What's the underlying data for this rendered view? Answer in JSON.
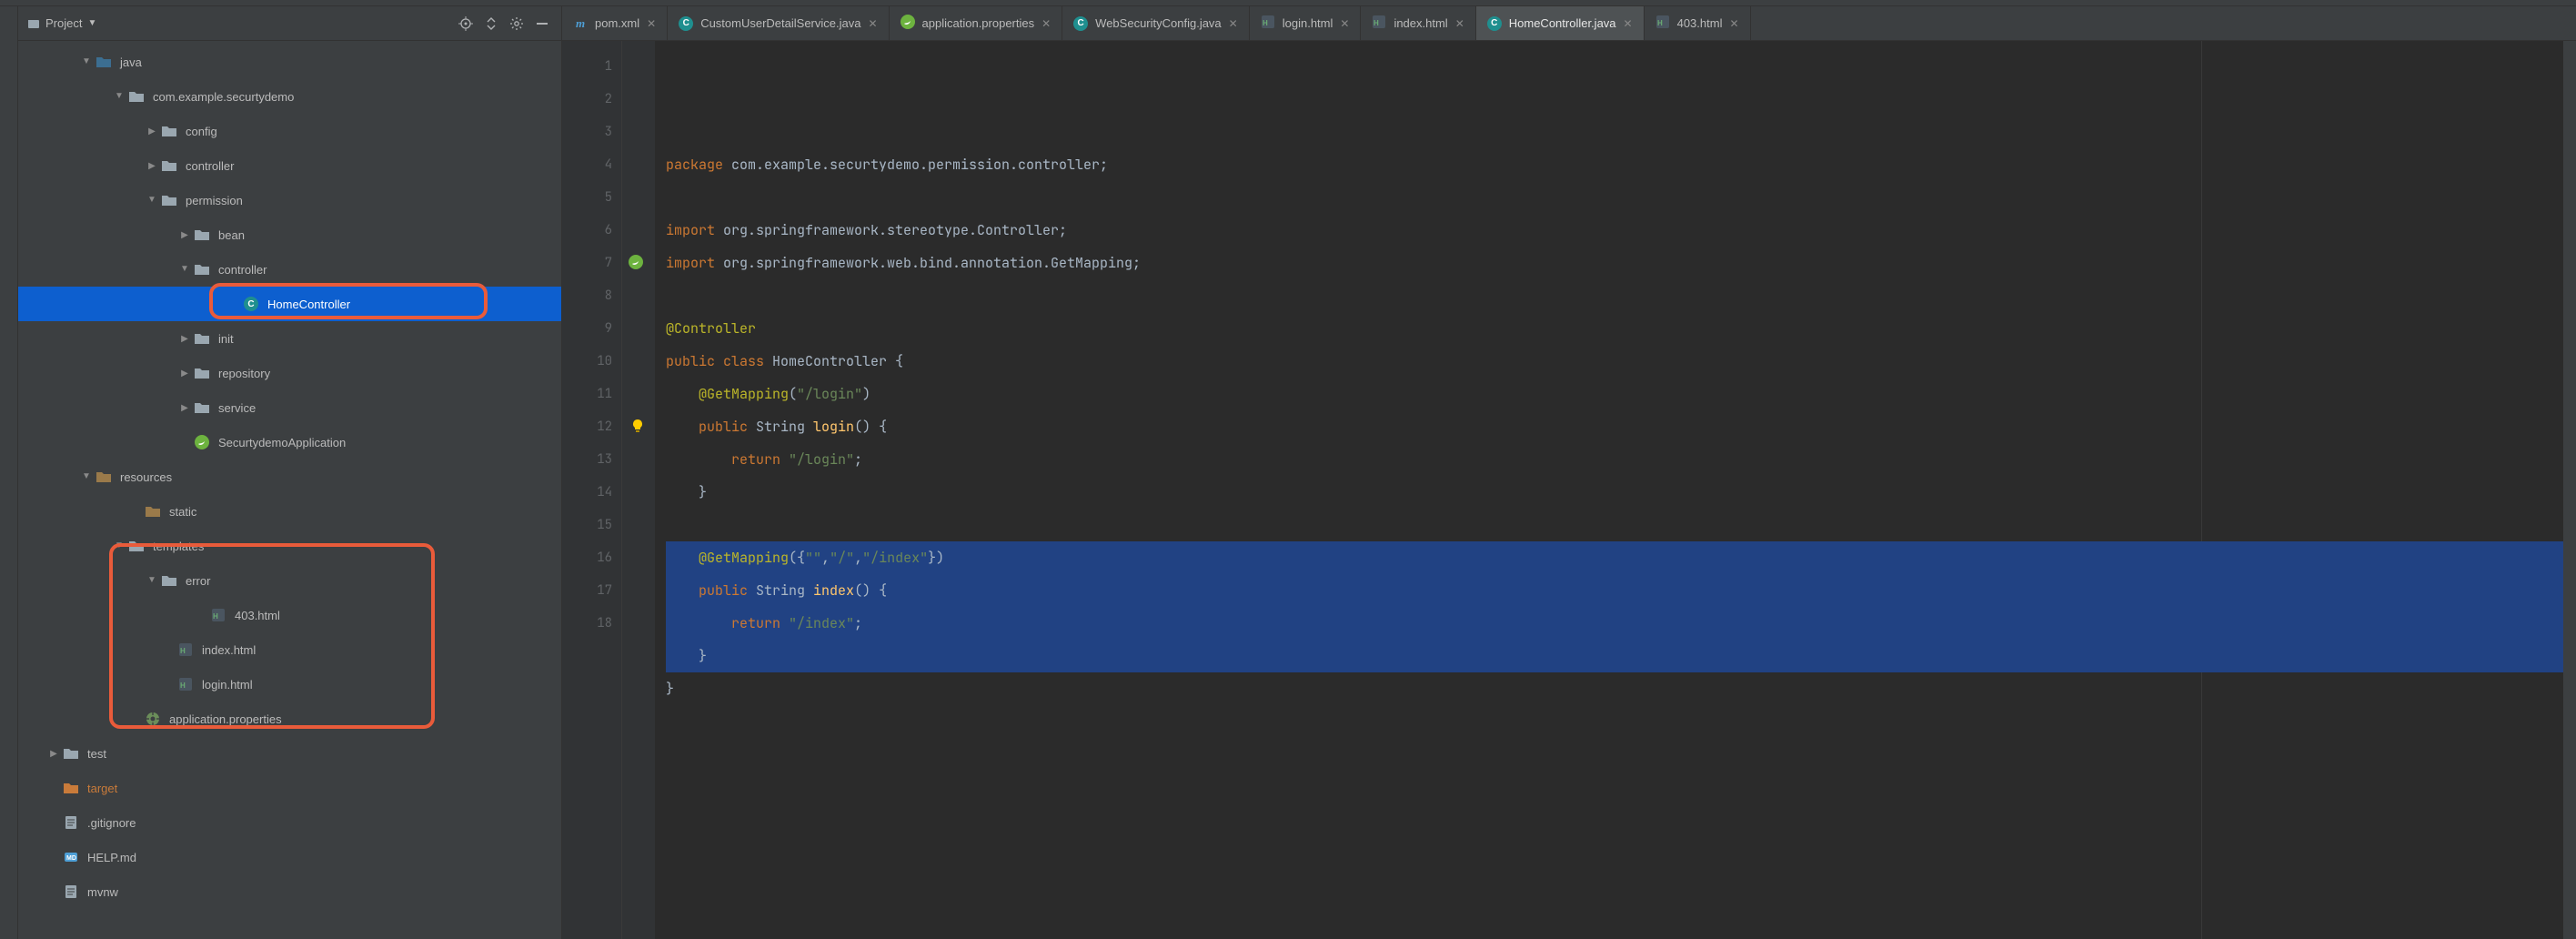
{
  "project": {
    "title": "Project",
    "toolbar": {
      "locate": "locate",
      "expand": "expand",
      "settings": "settings",
      "hide": "hide"
    }
  },
  "tree": {
    "java": "java",
    "pkg": "com.example.securtydemo",
    "config": "config",
    "controller": "controller",
    "permission": "permission",
    "bean": "bean",
    "perm_controller": "controller",
    "home_controller": "HomeController",
    "init": "init",
    "repository": "repository",
    "service": "service",
    "app_class": "SecurtydemoApplication",
    "resources": "resources",
    "static": "static",
    "templates": "templates",
    "error": "error",
    "f403": "403.html",
    "index_html": "index.html",
    "login_html": "login.html",
    "app_props": "application.properties",
    "test": "test",
    "target": "target",
    "gitignore": ".gitignore",
    "help_md": "HELP.md",
    "mvnw": "mvnw"
  },
  "tabs": [
    {
      "label": "pom.xml",
      "icon": "m",
      "active": false
    },
    {
      "label": "CustomUserDetailService.java",
      "icon": "c",
      "active": false
    },
    {
      "label": "application.properties",
      "icon": "prop",
      "active": false
    },
    {
      "label": "WebSecurityConfig.java",
      "icon": "c",
      "active": false
    },
    {
      "label": "login.html",
      "icon": "html",
      "active": false
    },
    {
      "label": "index.html",
      "icon": "html",
      "active": false
    },
    {
      "label": "HomeController.java",
      "icon": "c",
      "active": true
    },
    {
      "label": "403.html",
      "icon": "html",
      "active": false
    }
  ],
  "code": {
    "lines": [
      {
        "n": 1,
        "segs": [
          [
            "kw",
            "package "
          ],
          [
            "pkg",
            "com.example.securtydemo.permission.controller"
          ],
          [
            "punc",
            ";"
          ]
        ]
      },
      {
        "n": 2,
        "segs": [
          [
            "",
            ""
          ]
        ]
      },
      {
        "n": 3,
        "segs": [
          [
            "kw",
            "import "
          ],
          [
            "pkg",
            "org.springframework.stereotype."
          ],
          [
            "mapcls",
            "Controller"
          ],
          [
            "punc",
            ";"
          ]
        ]
      },
      {
        "n": 4,
        "segs": [
          [
            "kw",
            "import "
          ],
          [
            "pkg",
            "org.springframework.web.bind.annotation."
          ],
          [
            "mapcls",
            "GetMapping"
          ],
          [
            "punc",
            ";"
          ]
        ]
      },
      {
        "n": 5,
        "segs": [
          [
            "",
            ""
          ]
        ]
      },
      {
        "n": 6,
        "segs": [
          [
            "ann",
            "@Controller"
          ]
        ]
      },
      {
        "n": 7,
        "segs": [
          [
            "kw",
            "public class "
          ],
          [
            "cls",
            "HomeController"
          ],
          [
            "brace",
            " {"
          ]
        ]
      },
      {
        "n": 8,
        "segs": [
          [
            "",
            "    "
          ],
          [
            "ann",
            "@GetMapping"
          ],
          [
            "punc",
            "("
          ],
          [
            "str",
            "\"/login\""
          ],
          [
            "punc",
            ")"
          ]
        ]
      },
      {
        "n": 9,
        "segs": [
          [
            "",
            "    "
          ],
          [
            "kw",
            "public "
          ],
          [
            "cls",
            "String "
          ],
          [
            "fn",
            "login"
          ],
          [
            "punc",
            "()"
          ],
          [
            "brace",
            " {"
          ]
        ]
      },
      {
        "n": 10,
        "segs": [
          [
            "",
            "        "
          ],
          [
            "kw",
            "return "
          ],
          [
            "str",
            "\"/login\""
          ],
          [
            "punc",
            ";"
          ]
        ]
      },
      {
        "n": 11,
        "segs": [
          [
            "",
            "    "
          ],
          [
            "brace",
            "}"
          ]
        ]
      },
      {
        "n": 12,
        "segs": [
          [
            "",
            ""
          ]
        ]
      },
      {
        "n": 13,
        "segs": [
          [
            "",
            "    "
          ],
          [
            "ann",
            "@GetMapping"
          ],
          [
            "punc",
            "({"
          ],
          [
            "str",
            "\"\""
          ],
          [
            "punc",
            ","
          ],
          [
            "str",
            "\"/\""
          ],
          [
            "punc",
            ","
          ],
          [
            "str",
            "\"/index\""
          ],
          [
            "punc",
            "})"
          ]
        ],
        "sel": true,
        "cursor": true
      },
      {
        "n": 14,
        "segs": [
          [
            "",
            "    "
          ],
          [
            "kw",
            "public "
          ],
          [
            "cls",
            "String "
          ],
          [
            "fn",
            "index"
          ],
          [
            "punc",
            "()"
          ],
          [
            "brace",
            " {"
          ]
        ],
        "sel": true
      },
      {
        "n": 15,
        "segs": [
          [
            "",
            "        "
          ],
          [
            "kw",
            "return "
          ],
          [
            "str",
            "\"/index\""
          ],
          [
            "punc",
            ";"
          ]
        ],
        "sel": true
      },
      {
        "n": 16,
        "segs": [
          [
            "",
            "    "
          ],
          [
            "brace",
            "}"
          ]
        ],
        "sel": true
      },
      {
        "n": 17,
        "segs": [
          [
            "brace",
            "}"
          ]
        ]
      },
      {
        "n": 18,
        "segs": [
          [
            "",
            ""
          ]
        ]
      }
    ]
  }
}
